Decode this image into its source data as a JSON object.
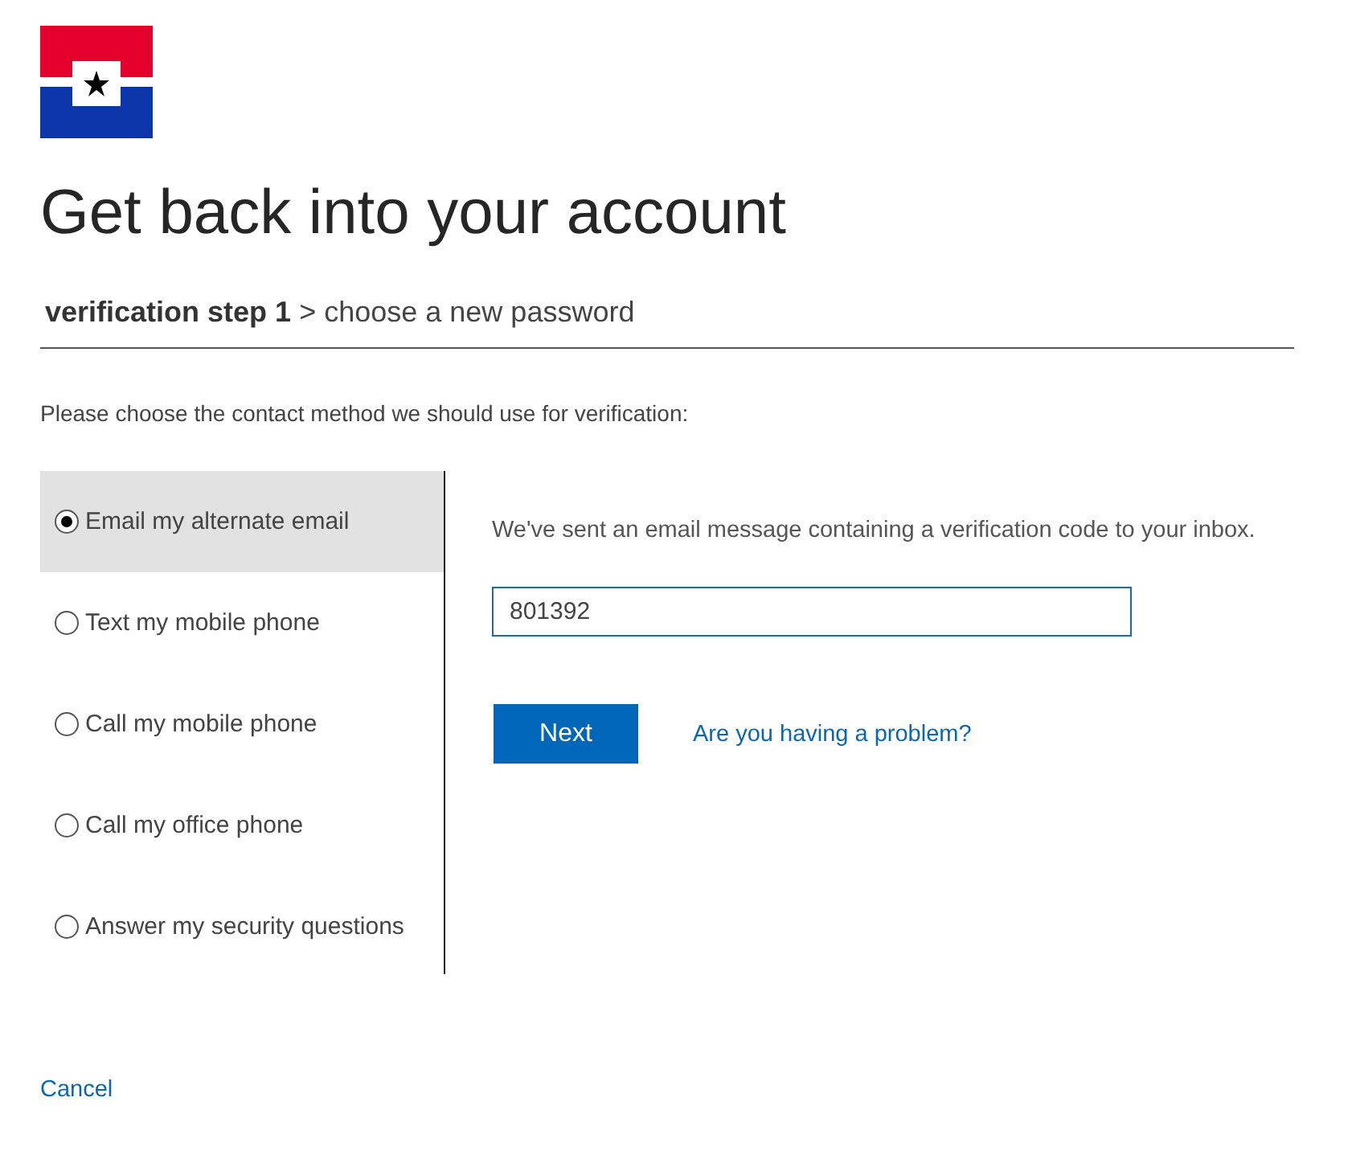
{
  "title": "Get back into your account",
  "breadcrumb": {
    "current": "verification step 1",
    "separator": ">",
    "next": "choose a new password"
  },
  "instruction": "Please choose the contact method we should use for verification:",
  "methods": [
    {
      "label": "Email my alternate email",
      "selected": true
    },
    {
      "label": "Text my mobile phone",
      "selected": false
    },
    {
      "label": "Call my mobile phone",
      "selected": false
    },
    {
      "label": "Call my office phone",
      "selected": false
    },
    {
      "label": "Answer my security questions",
      "selected": false
    }
  ],
  "message": "We've sent an email message containing a verification code to your inbox.",
  "code_field": {
    "value": "801392"
  },
  "next_button": "Next",
  "problem_link": "Are you having a problem?",
  "cancel_link": "Cancel"
}
